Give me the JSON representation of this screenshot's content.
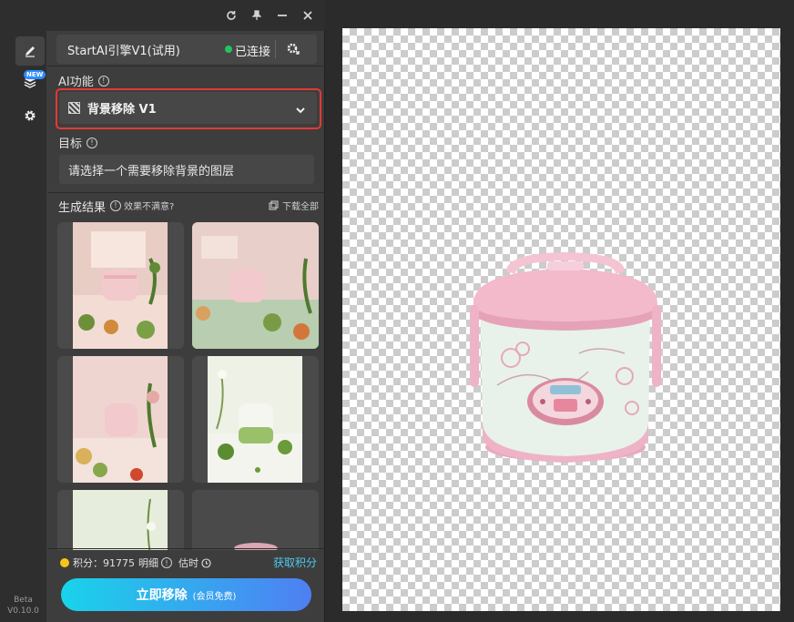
{
  "window": {
    "refresh_icon": "refresh-icon",
    "pin_icon": "pin-icon",
    "minimize_icon": "minimize-icon",
    "close_icon": "close-icon"
  },
  "sidebar": {
    "items": [
      {
        "icon": "pencil-icon",
        "active": true
      },
      {
        "icon": "layers-icon",
        "badge": "NEW"
      },
      {
        "icon": "gear-icon"
      }
    ],
    "version_line1": "Beta",
    "version_line2": "V0.10.0"
  },
  "engine": {
    "name": "StartAI引擎V1(试用)",
    "status": "已连接",
    "status_color": "#22c55e"
  },
  "ai_function": {
    "label": "AI功能",
    "selected": "背景移除 V1"
  },
  "target": {
    "label": "目标",
    "value": "请选择一个需要移除背景的图层"
  },
  "results": {
    "title": "生成结果",
    "unhappy": "效果不满意?",
    "download_all": "下载全部"
  },
  "credits": {
    "label": "积分：91775",
    "detail": "明细",
    "estimate": "估时",
    "get_credits": "获取积分"
  },
  "cta": {
    "main": "立即移除",
    "sub": "(会员免费)"
  },
  "colors": {
    "accent_start": "#19d3ea",
    "accent_end": "#4f7ff3",
    "highlight_border": "#e53935",
    "link": "#4cc9f0"
  }
}
